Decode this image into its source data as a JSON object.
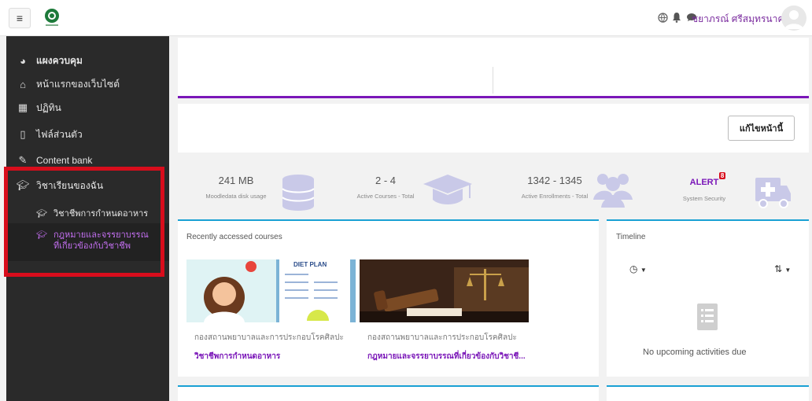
{
  "navbar": {
    "menu_icon": "hamburger-icon",
    "logo": "ministry-logo",
    "user_name": "ชยาภรณ์ ศรีสมุทรนาค",
    "icons": [
      "globe-icon",
      "bell-icon",
      "chat-icon"
    ]
  },
  "sidebar": {
    "items": [
      {
        "label": "แผงควบคุม",
        "icon": "dashboard-icon"
      },
      {
        "label": "หน้าแรกของเว็บไซต์",
        "icon": "home-icon"
      },
      {
        "label": "ปฏิทิน",
        "icon": "calendar-icon"
      },
      {
        "label": "ไฟล์ส่วนตัว",
        "icon": "file-icon"
      },
      {
        "label": "Content bank",
        "icon": "brush-icon"
      },
      {
        "label": "วิชาเรียนของฉัน",
        "icon": "graduation-cap-icon"
      }
    ],
    "courses": [
      {
        "label": "วิชาชีพการกำหนดอาหาร"
      },
      {
        "label_line1": "กฎหมายและจรรยาบรรณ",
        "label_line2": "ที่เกี่ยวข้องกับวิชาชีพ"
      }
    ]
  },
  "page": {
    "edit_button": "แก้ไขหน้านี้"
  },
  "stats": [
    {
      "value": "241 MB",
      "label": "Moodledata disk usage",
      "icon": "database-icon"
    },
    {
      "value": "2 - 4",
      "label": "Active Courses - Total",
      "icon": "graduation-cap-icon"
    },
    {
      "value": "1342 - 1345",
      "label": "Active Enrollments - Total",
      "icon": "users-icon"
    },
    {
      "value": "ALERT",
      "badge": "8",
      "label": "System Security",
      "icon": "ambulance-icon"
    }
  ],
  "recent": {
    "title": "Recently accessed courses",
    "image1_text": "DIET PLAN",
    "courses": [
      {
        "category": "กองสถานพยาบาลและการประกอบโรคศิลปะ",
        "name": "วิชาชีพการกำหนดอาหาร"
      },
      {
        "category": "กองสถานพยาบาลและการประกอบโรคศิลปะ",
        "name": "กฎหมายและจรรยาบรรณที่เกี่ยวข้องกับวิชาชี..."
      }
    ]
  },
  "timeline": {
    "title": "Timeline",
    "empty_text": "No upcoming activities due"
  },
  "colors": {
    "accent": "#7a16b8",
    "card_border": "#1aa1d4",
    "highlight": "#d80d1c",
    "sidebar_bg": "#2a2a2a"
  }
}
